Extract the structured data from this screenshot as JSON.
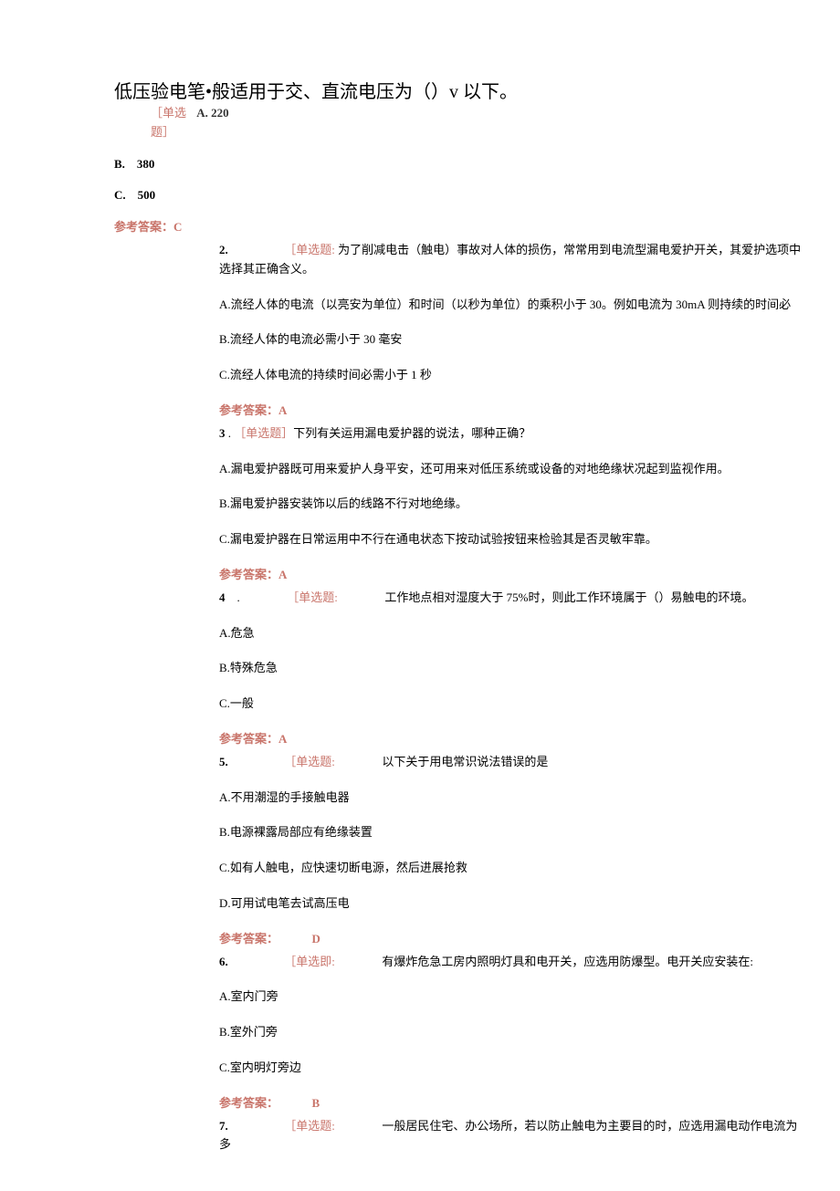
{
  "q1": {
    "title": "低压验电笔•般适用于交、直流电压为（）v 以下。",
    "tag1": "［单选",
    "a220_label": "A.",
    "a220_val": "220",
    "tag2": "题］",
    "optB": "B.　380",
    "optC": "C.　500",
    "answer": "参考答案：C"
  },
  "q2": {
    "num": "2.",
    "tag": "［单选题:",
    "text": "为了削减电击（触电）事故对人体的损伤，常常用到电流型漏电爱护开关，其爱护选项中选择其正确含义。",
    "A": "A.流经人体的电流（以亮安为单位）和时间（以秒为单位）的乘积小于 30。例如电流为 30mA 则持续的时间必",
    "B": "B.流经人体的电流必需小于 30 毫安",
    "C": "C.流经人体电流的持续时间必需小于 1 秒",
    "answer": "参考答案：A"
  },
  "q3": {
    "num": "3",
    "sep": " . ",
    "tag": "［单选题］",
    "text": "下列有关运用漏电爱护器的说法，哪种正确？",
    "A": "A.漏电爱护器既可用来爱护人身平安，还可用来对低压系统或设备的对地绝缘状况起到监视作用。",
    "B": "B.漏电爱护器安装饰以后的线路不行对地绝缘。",
    "C": "C.漏电爱护器在日常运用中不行在通电状态下按动试验按钮来检验其是否灵敏牢靠。",
    "answer": "参考答案：A"
  },
  "q4": {
    "num": "4",
    "sep": "　.",
    "tag": "［单选题:",
    "text": "工作地点相对湿度大于 75%时，则此工作环境属于（）易触电的环境。",
    "A": "A.危急",
    "B": "B.特殊危急",
    "C": "C.一般",
    "answer": "参考答案：A"
  },
  "q5": {
    "num": "5.",
    "tag": "［单选题:",
    "text": "以下关于用电常识说法错误的是",
    "A": "A.不用潮湿的手接触电器",
    "B": "B.电源裸露局部应有绝缘装置",
    "C": "C.如有人触电，应快速切断电源，然后进展抢救",
    "D": "D.可用试电笔去试高压电",
    "answer_label": "参考答案：",
    "answer_val": "D"
  },
  "q6": {
    "num": "6.",
    "tag": "［单选即:",
    "text": "有爆炸危急工房内照明灯具和电开关，应选用防爆型。电开关应安装在:",
    "A": "A.室内门旁",
    "B": "B.室外门旁",
    "C": "C.室内明灯旁边",
    "answer_label": "参考答案：",
    "answer_val": "B"
  },
  "q7": {
    "num": "7.",
    "tag": "［单选题:",
    "text": "一般居民住宅、办公场所，若以防止触电为主要目的时，应选用漏电动作电流为多"
  }
}
